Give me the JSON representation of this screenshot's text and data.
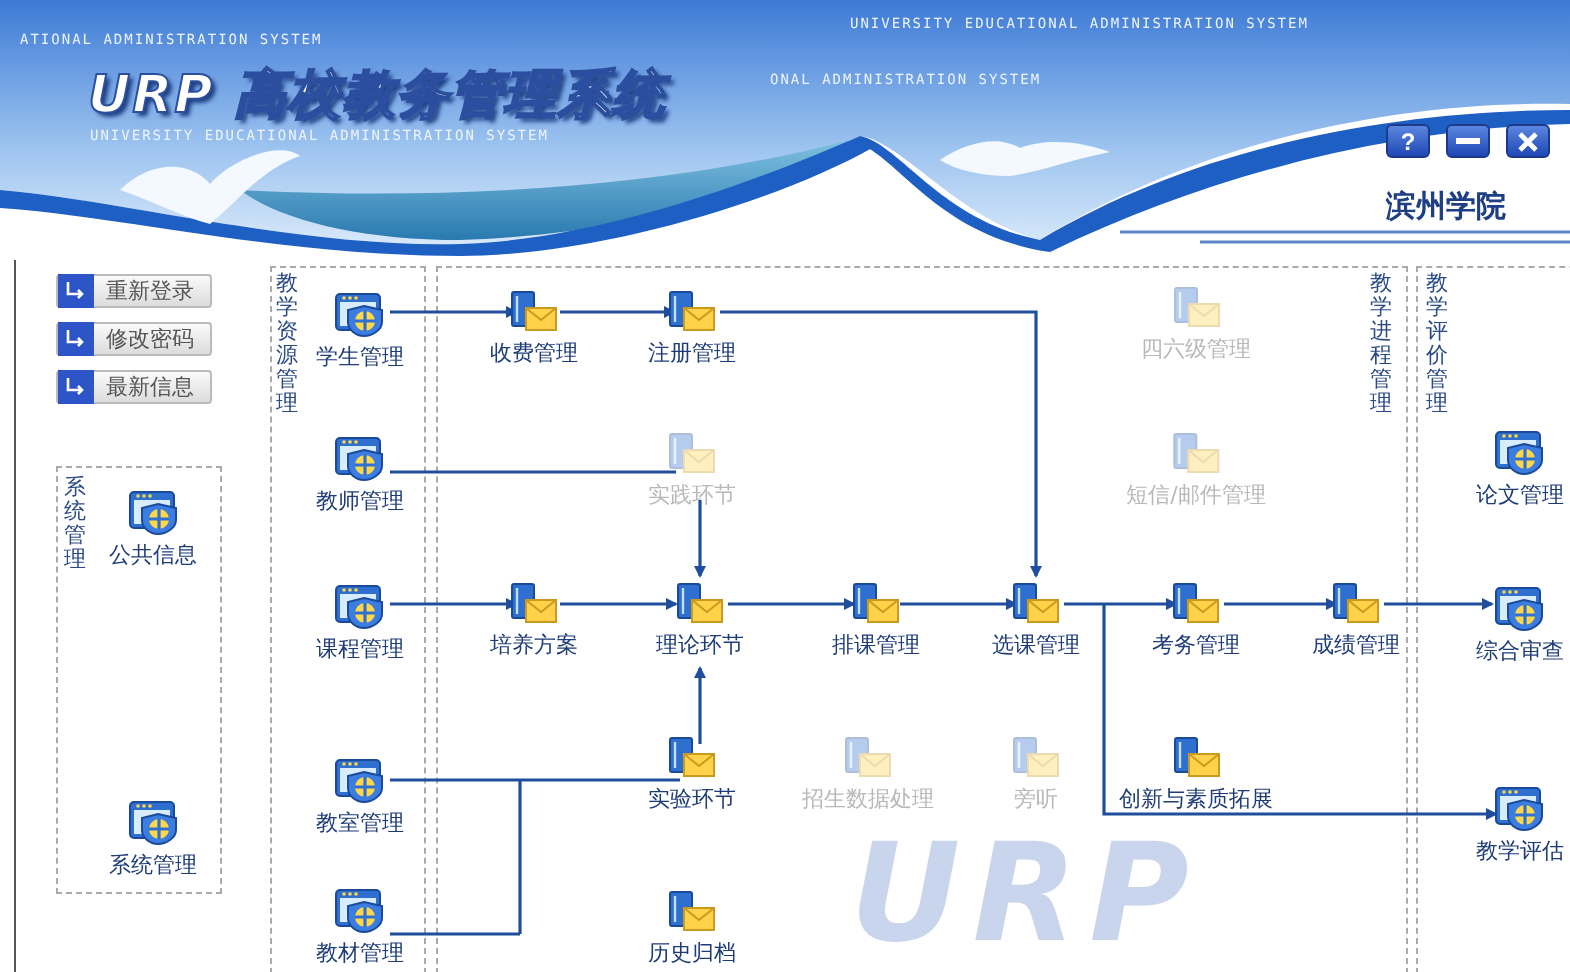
{
  "header": {
    "title": "URP 高校教务管理系统",
    "taglines": [
      "ATIONAL ADMINISTRATION SYSTEM",
      "UNIVERSITY EDUCATIONAL ADMINISTRATION SYSTEM",
      "ONAL ADMINISTRATION SYSTEM",
      "UNIVERSITY EDUCATIONAL ADMINISTRATION SYSTEM"
    ],
    "school": "滨州学院",
    "buttons": [
      {
        "kind": "help",
        "label": "?"
      },
      {
        "kind": "minimize"
      },
      {
        "kind": "close"
      }
    ]
  },
  "quick_links": [
    "重新登录",
    "修改密码",
    "最新信息"
  ],
  "system_group": {
    "title": "系统管理",
    "items": [
      "公共信息",
      "系统管理"
    ]
  },
  "groups": [
    {
      "title": "教学资源管理"
    },
    {
      "title": "教学进程管理"
    },
    {
      "title": "教学评价管理"
    }
  ],
  "nodes": [
    {
      "label": "学生管理",
      "kind": "module",
      "disabled": false
    },
    {
      "label": "收费管理",
      "kind": "function",
      "disabled": false
    },
    {
      "label": "注册管理",
      "kind": "function",
      "disabled": false
    },
    {
      "label": "四六级管理",
      "kind": "function",
      "disabled": true
    },
    {
      "label": "教师管理",
      "kind": "module",
      "disabled": false
    },
    {
      "label": "实践环节",
      "kind": "function",
      "disabled": true
    },
    {
      "label": "短信/邮件管理",
      "kind": "function",
      "disabled": true
    },
    {
      "label": "论文管理",
      "kind": "module",
      "disabled": false
    },
    {
      "label": "课程管理",
      "kind": "module",
      "disabled": false
    },
    {
      "label": "培养方案",
      "kind": "function",
      "disabled": false
    },
    {
      "label": "理论环节",
      "kind": "function",
      "disabled": false
    },
    {
      "label": "排课管理",
      "kind": "function",
      "disabled": false
    },
    {
      "label": "选课管理",
      "kind": "function",
      "disabled": false
    },
    {
      "label": "考务管理",
      "kind": "function",
      "disabled": false
    },
    {
      "label": "成绩管理",
      "kind": "function",
      "disabled": false
    },
    {
      "label": "综合审查",
      "kind": "module",
      "disabled": false
    },
    {
      "label": "实验环节",
      "kind": "function",
      "disabled": false
    },
    {
      "label": "招生数据处理",
      "kind": "function",
      "disabled": true
    },
    {
      "label": "旁听",
      "kind": "function",
      "disabled": true
    },
    {
      "label": "创新与素质拓展",
      "kind": "function",
      "disabled": false
    },
    {
      "label": "教室管理",
      "kind": "module",
      "disabled": false
    },
    {
      "label": "教学评估",
      "kind": "module",
      "disabled": false
    },
    {
      "label": "教材管理",
      "kind": "module",
      "disabled": false
    },
    {
      "label": "历史归档",
      "kind": "function",
      "disabled": false
    }
  ],
  "watermark": "URP"
}
